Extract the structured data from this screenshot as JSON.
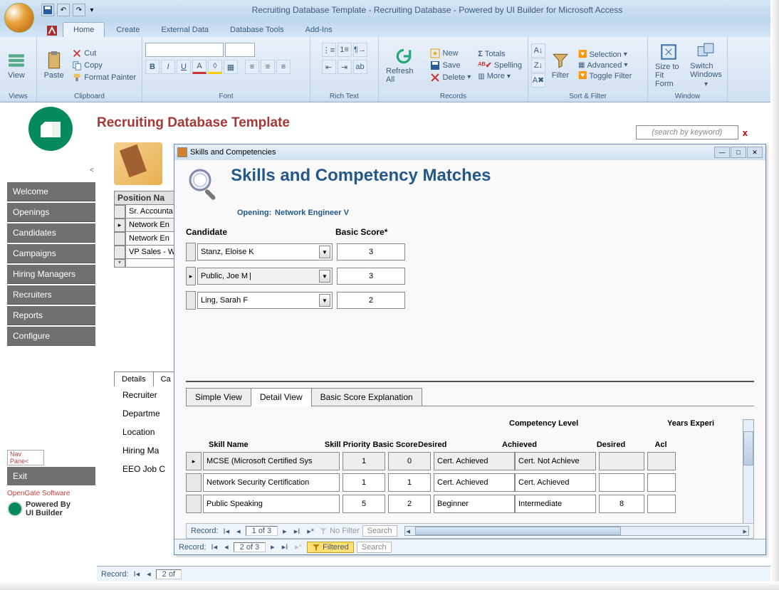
{
  "app": {
    "title": "Recruiting Database Template - Recruiting Database - Powered by UI Builder for Microsoft Access"
  },
  "ribbon": {
    "tabs": [
      "Home",
      "Create",
      "External Data",
      "Database Tools",
      "Add-Ins"
    ],
    "groups": {
      "views": {
        "label": "Views",
        "view": "View"
      },
      "clipboard": {
        "label": "Clipboard",
        "paste": "Paste",
        "cut": "Cut",
        "copy": "Copy",
        "fmt": "Format Painter"
      },
      "font": {
        "label": "Font"
      },
      "richtext": {
        "label": "Rich Text"
      },
      "records": {
        "label": "Records",
        "refresh": "Refresh All",
        "new": "New",
        "save": "Save",
        "delete": "Delete",
        "totals": "Totals",
        "spelling": "Spelling",
        "more": "More"
      },
      "sortfilter": {
        "label": "Sort & Filter",
        "filter": "Filter",
        "selection": "Selection",
        "advanced": "Advanced",
        "toggle": "Toggle Filter"
      },
      "window": {
        "label": "Window",
        "fit": "Size to Fit Form",
        "switch": "Switch Windows"
      }
    }
  },
  "page": {
    "title": "Recruiting Database Template",
    "search_placeholder": "(search by keyword)"
  },
  "nav": {
    "items": [
      "Welcome",
      "Openings",
      "Candidates",
      "Campaigns",
      "Hiring Managers",
      "Recruiters",
      "Reports",
      "Configure"
    ],
    "navpane": "Nav Pane<",
    "exit": "Exit",
    "opengate": "OpenGate Software",
    "powered1": "Powered By",
    "powered2": "UI Builder"
  },
  "positions": {
    "header": "Position Na",
    "rows": [
      "Sr. Accounta",
      "Network En",
      "Network En",
      "VP Sales - W",
      ""
    ]
  },
  "behind_tabs": {
    "tab1": "Details",
    "tab2": "Ca"
  },
  "behind_fields": [
    "Recruiter",
    "Departme",
    "Location",
    "Hiring Ma",
    "EEO Job C"
  ],
  "popup": {
    "title": "Skills and Competencies",
    "h1": "Skills and Competency Matches",
    "h2a": "Opening:",
    "h2b": "Network Engineer V",
    "cand_hdr": "Candidate",
    "score_hdr": "Basic Score*",
    "candidates": [
      {
        "name": "Stanz, Eloise K",
        "score": "3",
        "selected": false
      },
      {
        "name": "Public, Joe M",
        "score": "3",
        "selected": true
      },
      {
        "name": "Ling, Sarah F",
        "score": "2",
        "selected": false
      }
    ],
    "view_tabs": [
      "Simple View",
      "Detail View",
      "Basic Score Explanation"
    ],
    "dg": {
      "hdr_name": "Skill Name",
      "hdr_prio": "Skill Priority",
      "hdr_score": "Basic Score",
      "hdr_comp": "Competency Level",
      "hdr_des": "Desired",
      "hdr_ach": "Achieved",
      "hdr_yrs": "Years Experi",
      "hdr_yd": "Desired",
      "hdr_ya": "Acl",
      "rows": [
        {
          "name": "MCSE (Microsoft Certified Sys",
          "prio": "1",
          "score": "0",
          "des": "Cert. Achieved",
          "ach": "Cert. Not Achieve",
          "yd": "",
          "ya": "",
          "active": true
        },
        {
          "name": "Network Security Certification",
          "prio": "1",
          "score": "1",
          "des": "Cert. Achieved",
          "ach": "Cert. Achieved",
          "yd": "",
          "ya": "",
          "active": false
        },
        {
          "name": "Public Speaking",
          "prio": "5",
          "score": "2",
          "des": "Beginner",
          "ach": "Intermediate",
          "yd": "8",
          "ya": "",
          "active": false
        }
      ]
    },
    "inner_nav": {
      "record": "Record:",
      "pos": "1 of 3",
      "nofilter": "No Filter",
      "search": "Search"
    },
    "outer_nav": {
      "record": "Record:",
      "pos": "2 of 3",
      "filtered": "Filtered",
      "search": "Search"
    }
  },
  "main_nav": {
    "record": "Record:",
    "pos": "2 of"
  }
}
